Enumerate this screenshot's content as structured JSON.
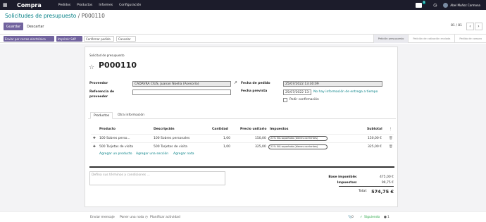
{
  "navbar": {
    "app_name": "Compra",
    "menus": [
      "Pedidos",
      "Productos",
      "Informes",
      "Configuración"
    ],
    "chat_count": "5",
    "user_name": "Abel Muñoz Carmona"
  },
  "breadcrumb": {
    "parent": "Solicitudes de presupuesto",
    "current": "P000110"
  },
  "actions": {
    "save": "Guardar",
    "discard": "Descartar"
  },
  "pager": {
    "value": "81 / 81"
  },
  "status_actions": [
    "Enviar por correo electrónico",
    "Imprimir SdP",
    "Confirmar pedido",
    "Cancelar"
  ],
  "stages": [
    "Petición presupuesto",
    "Petición de cotización enviada",
    "Pedido de compra"
  ],
  "form": {
    "doc_label": "Solicitud de presupuesto",
    "doc_name": "P000110",
    "vendor_label": "Proveedor",
    "vendor_value": "CADAVRA CIUS, Juanan Noelia (Asesoría)",
    "ref_label": "Referencia de proveedor",
    "ref_value": "",
    "order_date_label": "Fecha de pedido",
    "order_date_value": "25/07/2022 13:30:09",
    "expected_label": "Fecha prevista",
    "expected_value": "25/07/2022 13:",
    "expected_note": "No hay información de entrega a tiempo",
    "confirm_label": "Pedir confirmación"
  },
  "tabs": [
    "Productos",
    "Otra información"
  ],
  "table": {
    "headers": [
      "Producto",
      "Descripción",
      "Cantidad",
      "Precio unitario",
      "Impuestos",
      "Subtotal"
    ],
    "rows": [
      {
        "product": "100 Sobres perso...",
        "description": "100 Sobres personales",
        "qty": "1,00",
        "price": "150,00",
        "tax": "21% IVA soportado (bienes corrientes)",
        "subtotal": "150,00 €"
      },
      {
        "product": "500 Tarjetas de visita",
        "description": "500 Tarjetas de visita",
        "qty": "1,00",
        "price": "325,00",
        "tax": "21% IVA soportado (bienes corrientes)",
        "subtotal": "325,00 €"
      }
    ]
  },
  "add_links": [
    "Agregar un producto",
    "Agregar una sección",
    "Agregar nota"
  ],
  "terms_placeholder": "Defina sus términos y condiciones ...",
  "totals": {
    "base_label": "Base imponible:",
    "base_value": "475,00 €",
    "tax_label": "Impuestos:",
    "tax_value": "99,75 €",
    "total_label": "Total:",
    "total_value": "574,75 €"
  },
  "chatter": {
    "send": "Enviar mensaje",
    "note": "Poner una nota",
    "activity": "Planificar actividad",
    "attachments": "0",
    "following": "Siguiendo",
    "followers": "1"
  }
}
